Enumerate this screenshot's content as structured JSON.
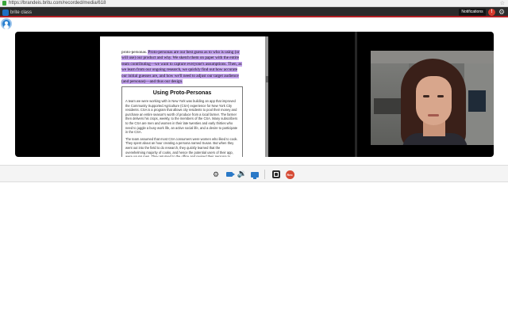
{
  "browser": {
    "url": "https://brandeis.britu.com/recorded/media/618"
  },
  "app": {
    "logo_text": "brite class",
    "notifications_label": "Notifications",
    "alert_symbol": "!",
    "colors": {
      "accent_red": "#b41f24",
      "brand_blue": "#1c6fc4",
      "highlight_purple": "#c3a2ee",
      "record_red": "#d64b35"
    }
  },
  "document": {
    "highlight_lead": "proto-personas.",
    "highlight_text": "Proto-personas are our best guess as to who is using (or will use) our product and why. We sketch them on paper with the entire team contributing—we want to capture everyone's assumptions. Then, as we learn from our ongoing research, we quickly find out how accurate our initial guesses are, and how we'll need to adjust our target audience (and personas)—and thus our design.",
    "sidebar_title": "Using Proto-Personas",
    "sidebar_paragraphs": [
      "A team we were working with in New York was building an app that improved the Community Supported Agriculture (CSA) experience for New York City residents. CSA is a program that allows city residents to pool their money and purchase an entire season's worth of produce from a local farmer. The farmer then delivers his crops, weekly, to the members of the CSA. Many subscribers to the CSA are men and women in their late twenties and early thirties who need to juggle a busy work life, an active social life, and a desire to participate in the CSA.",
      "The team assumed that most CSA consumers were women who liked to cook. They spent about an hour creating a persona named Susan. But when they went out into the field to do research, they quickly learned that the overwhelming majority of cooks, and hence the potential users of their app, were young men. They returned to the office and revised their persona to create Timothy (Figure 5-4)."
    ]
  },
  "toolbar": {
    "settings_icon": "gear-icon",
    "camera_icon": "video-camera-icon",
    "volume_icon": "speaker-icon",
    "screen_icon": "screen-share-icon",
    "stop_icon": "stop-icon",
    "record_label": "Rec"
  }
}
